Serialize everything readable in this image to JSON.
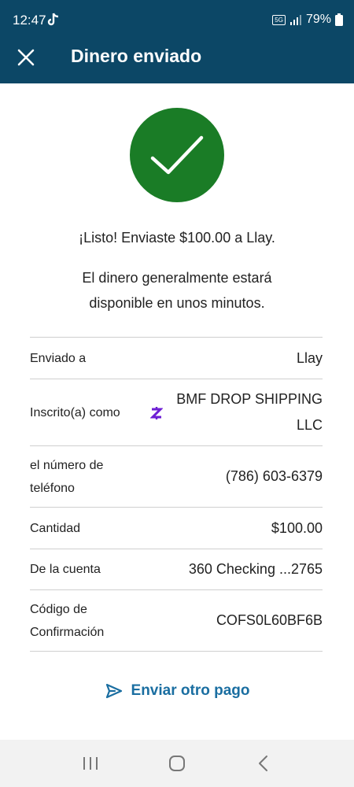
{
  "status_bar": {
    "time": "12:47",
    "network": "5G",
    "battery": "79%"
  },
  "header": {
    "title": "Dinero enviado"
  },
  "confirmation": {
    "message": "¡Listo! Enviaste $100.00 a Llay.",
    "info_line1": "El dinero generalmente estará",
    "info_line2": "disponible en unos minutos."
  },
  "details": {
    "sent_to": {
      "label": "Enviado a",
      "value": "Llay"
    },
    "enrolled_as": {
      "label": "Inscrito(a) como",
      "value_line1": "BMF DROP SHIPPING",
      "value_line2": "LLC"
    },
    "phone": {
      "label_line1": "el número de",
      "label_line2": "teléfono",
      "value": "(786) 603-6379"
    },
    "amount": {
      "label": "Cantidad",
      "value": "$100.00"
    },
    "account": {
      "label": "De la cuenta",
      "value": "360 Checking ...2765"
    },
    "confirmation_code": {
      "label_line1": "Código de",
      "label_line2": "Confirmación",
      "value": "COFS0L60BF6B"
    }
  },
  "actions": {
    "send_another": "Enviar otro pago"
  },
  "colors": {
    "header_bg": "#0c4766",
    "success_green": "#1a7c26",
    "link_blue": "#1a6ea1",
    "zelle_purple": "#6d1ed4"
  },
  "icons": {
    "close": "close-icon",
    "success": "checkmark-icon",
    "zelle": "zelle-icon",
    "send": "send-icon"
  }
}
